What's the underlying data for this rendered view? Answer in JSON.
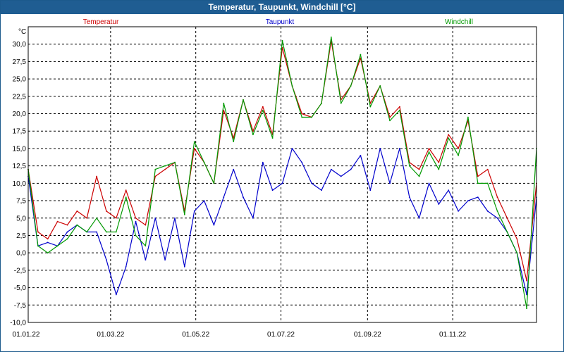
{
  "window": {
    "title": "Temperatur, Taupunkt, Windchill [°C]"
  },
  "chart_data": {
    "type": "line",
    "title": "Temperatur, Taupunkt, Windchill [°C]",
    "ylabel": "°C",
    "xlabel": "",
    "ylim": [
      -10.0,
      32.5
    ],
    "yticks": [
      "30,0",
      "27,5",
      "25,0",
      "22,5",
      "20,0",
      "17,5",
      "15,0",
      "12,5",
      "10,0",
      "7,5",
      "5,0",
      "2,5",
      "0,0",
      "-2,5",
      "-5,0",
      "-7,5",
      "-10,0"
    ],
    "xlim": [
      "01.01.22",
      "31.12.22"
    ],
    "xticks": [
      "01.01.22",
      "01.03.22",
      "01.05.22",
      "01.07.22",
      "01.09.22",
      "01.11.22"
    ],
    "grid": true,
    "legend_placement": "top",
    "x": [
      "01.01.22",
      "08.01.22",
      "15.01.22",
      "22.01.22",
      "29.01.22",
      "05.02.22",
      "12.02.22",
      "19.02.22",
      "26.02.22",
      "05.03.22",
      "12.03.22",
      "19.03.22",
      "26.03.22",
      "02.04.22",
      "09.04.22",
      "16.04.22",
      "23.04.22",
      "30.04.22",
      "07.05.22",
      "14.05.22",
      "21.05.22",
      "28.05.22",
      "04.06.22",
      "11.06.22",
      "18.06.22",
      "25.06.22",
      "02.07.22",
      "09.07.22",
      "16.07.22",
      "23.07.22",
      "30.07.22",
      "06.08.22",
      "13.08.22",
      "20.08.22",
      "27.08.22",
      "03.09.22",
      "10.09.22",
      "17.09.22",
      "24.09.22",
      "01.10.22",
      "08.10.22",
      "15.10.22",
      "22.10.22",
      "29.10.22",
      "05.11.22",
      "12.11.22",
      "19.11.22",
      "26.11.22",
      "03.12.22",
      "10.12.22",
      "17.12.22",
      "24.12.22",
      "31.12.22"
    ],
    "series": [
      {
        "name": "Temperatur",
        "color": "#cc0000",
        "values": [
          12.0,
          3.0,
          2.0,
          4.5,
          4.0,
          6.0,
          5.0,
          11.0,
          6.0,
          5.0,
          9.0,
          5.0,
          4.0,
          11.0,
          12.0,
          13.0,
          6.0,
          15.0,
          13.0,
          10.0,
          20.5,
          16.5,
          22.0,
          17.5,
          21.0,
          17.0,
          29.5,
          24.0,
          20.0,
          19.5,
          21.5,
          30.5,
          22.0,
          24.0,
          28.0,
          21.5,
          24.0,
          19.5,
          21.0,
          13.0,
          12.0,
          15.0,
          13.0,
          17.0,
          15.0,
          19.0,
          11.0,
          12.0,
          8.0,
          5.0,
          2.0,
          -4.0,
          10.0
        ]
      },
      {
        "name": "Taupunkt",
        "color": "#0000cc",
        "values": [
          11.0,
          1.0,
          1.5,
          1.0,
          3.0,
          4.0,
          3.0,
          3.0,
          -1.0,
          -6.0,
          -2.0,
          4.5,
          -1.0,
          5.0,
          -1.0,
          5.0,
          -2.0,
          6.0,
          7.5,
          4.0,
          8.0,
          12.0,
          8.0,
          5.0,
          13.0,
          9.0,
          10.0,
          15.0,
          13.0,
          10.0,
          9.0,
          12.0,
          11.0,
          12.0,
          14.0,
          9.0,
          15.0,
          10.0,
          15.0,
          8.0,
          5.0,
          10.0,
          7.0,
          9.0,
          6.0,
          7.5,
          8.0,
          6.0,
          5.0,
          3.0,
          0.0,
          -6.0,
          8.0
        ]
      },
      {
        "name": "Windchill",
        "color": "#009900",
        "values": [
          12.0,
          1.0,
          0.0,
          1.0,
          2.0,
          4.0,
          3.0,
          5.0,
          3.0,
          3.0,
          8.0,
          2.5,
          1.0,
          12.0,
          12.5,
          13.0,
          5.5,
          16.0,
          13.0,
          10.0,
          21.5,
          16.0,
          22.0,
          17.0,
          20.5,
          16.5,
          30.5,
          24.0,
          19.5,
          19.5,
          21.5,
          31.0,
          21.5,
          24.0,
          28.5,
          21.0,
          24.0,
          19.0,
          20.5,
          12.5,
          11.0,
          14.5,
          12.0,
          16.5,
          14.0,
          19.5,
          10.0,
          10.0,
          6.0,
          3.0,
          0.0,
          -8.0,
          15.0
        ]
      }
    ]
  }
}
